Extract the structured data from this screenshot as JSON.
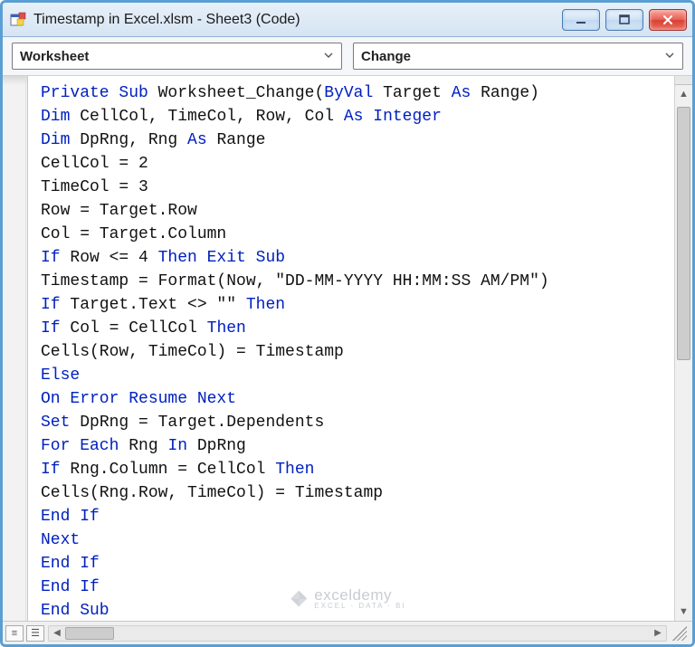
{
  "window": {
    "title": "Timestamp in Excel.xlsm - Sheet3 (Code)"
  },
  "dropdowns": {
    "object": "Worksheet",
    "procedure": "Change"
  },
  "code": {
    "lines": [
      [
        {
          "t": "Private Sub ",
          "c": "kw"
        },
        {
          "t": "Worksheet_Change(",
          "c": ""
        },
        {
          "t": "ByVal ",
          "c": "kw"
        },
        {
          "t": "Target ",
          "c": ""
        },
        {
          "t": "As ",
          "c": "kw"
        },
        {
          "t": "Range)",
          "c": ""
        }
      ],
      [
        {
          "t": "Dim ",
          "c": "kw"
        },
        {
          "t": "CellCol, TimeCol, Row, Col ",
          "c": ""
        },
        {
          "t": "As Integer",
          "c": "kw"
        }
      ],
      [
        {
          "t": "Dim ",
          "c": "kw"
        },
        {
          "t": "DpRng, Rng ",
          "c": ""
        },
        {
          "t": "As ",
          "c": "kw"
        },
        {
          "t": "Range",
          "c": ""
        }
      ],
      [
        {
          "t": "CellCol = 2",
          "c": ""
        }
      ],
      [
        {
          "t": "TimeCol = 3",
          "c": ""
        }
      ],
      [
        {
          "t": "Row = Target.Row",
          "c": ""
        }
      ],
      [
        {
          "t": "Col = Target.Column",
          "c": ""
        }
      ],
      [
        {
          "t": "If ",
          "c": "kw"
        },
        {
          "t": "Row <= 4 ",
          "c": ""
        },
        {
          "t": "Then Exit Sub",
          "c": "kw"
        }
      ],
      [
        {
          "t": "Timestamp = Format(Now, \"DD-MM-YYYY HH:MM:SS AM/PM\")",
          "c": ""
        }
      ],
      [
        {
          "t": "If ",
          "c": "kw"
        },
        {
          "t": "Target.Text <> \"\" ",
          "c": ""
        },
        {
          "t": "Then",
          "c": "kw"
        }
      ],
      [
        {
          "t": "If ",
          "c": "kw"
        },
        {
          "t": "Col = CellCol ",
          "c": ""
        },
        {
          "t": "Then",
          "c": "kw"
        }
      ],
      [
        {
          "t": "Cells(Row, TimeCol) = Timestamp",
          "c": ""
        }
      ],
      [
        {
          "t": "Else",
          "c": "kw"
        }
      ],
      [
        {
          "t": "On Error Resume Next",
          "c": "kw"
        }
      ],
      [
        {
          "t": "Set ",
          "c": "kw"
        },
        {
          "t": "DpRng = Target.Dependents",
          "c": ""
        }
      ],
      [
        {
          "t": "For Each ",
          "c": "kw"
        },
        {
          "t": "Rng ",
          "c": ""
        },
        {
          "t": "In ",
          "c": "kw"
        },
        {
          "t": "DpRng",
          "c": ""
        }
      ],
      [
        {
          "t": "If ",
          "c": "kw"
        },
        {
          "t": "Rng.Column = CellCol ",
          "c": ""
        },
        {
          "t": "Then",
          "c": "kw"
        }
      ],
      [
        {
          "t": "Cells(Rng.Row, TimeCol) = Timestamp",
          "c": ""
        }
      ],
      [
        {
          "t": "End If",
          "c": "kw"
        }
      ],
      [
        {
          "t": "Next",
          "c": "kw"
        }
      ],
      [
        {
          "t": "End If",
          "c": "kw"
        }
      ],
      [
        {
          "t": "End If",
          "c": "kw"
        }
      ],
      [
        {
          "t": "End Sub",
          "c": "kw"
        }
      ]
    ]
  },
  "watermark": {
    "brand": "exceldemy",
    "tag": "EXCEL · DATA · BI"
  }
}
